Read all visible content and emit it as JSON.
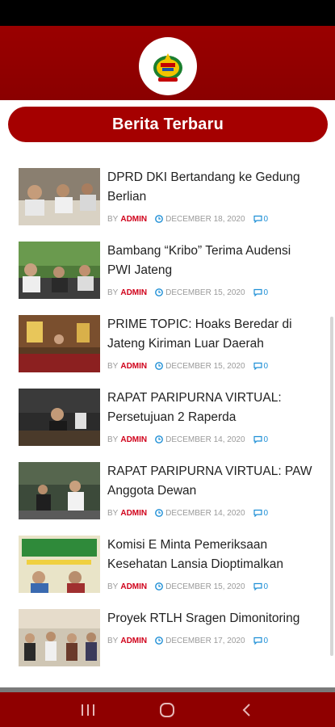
{
  "header": {
    "logo": "provincial-crest-logo",
    "section_title": "Berita Terbaru"
  },
  "colors": {
    "header_bg": "#9a0000",
    "title_pill": "#a50000",
    "author": "#d0021b",
    "accent_blue": "#1e8fd6",
    "nav_bg": "#8f0000"
  },
  "articles": [
    {
      "title": "DPRD DKI Bertandang ke Gedung Berlian",
      "by": "BY",
      "author": "ADMIN",
      "date": "DECEMBER 18, 2020",
      "comments": "0"
    },
    {
      "title": "Bambang “Kribo” Terima Audensi PWI Jateng",
      "by": "BY",
      "author": "ADMIN",
      "date": "DECEMBER 15, 2020",
      "comments": "0"
    },
    {
      "title": "PRIME TOPIC: Hoaks Beredar di Jateng Kiriman Luar Daerah",
      "by": "BY",
      "author": "ADMIN",
      "date": "DECEMBER 15, 2020",
      "comments": "0"
    },
    {
      "title": "RAPAT PARIPURNA VIRTUAL: Persetujuan 2 Raperda",
      "by": "BY",
      "author": "ADMIN",
      "date": "DECEMBER 14, 2020",
      "comments": "0"
    },
    {
      "title": "RAPAT PARIPURNA VIRTUAL: PAW Anggota Dewan",
      "by": "BY",
      "author": "ADMIN",
      "date": "DECEMBER 14, 2020",
      "comments": "0"
    },
    {
      "title": "Komisi E Minta Pemeriksaan Kesehatan Lansia Dioptimalkan",
      "by": "BY",
      "author": "ADMIN",
      "date": "DECEMBER 15, 2020",
      "comments": "0"
    },
    {
      "title": "Proyek RTLH Sragen Dimonitoring",
      "by": "BY",
      "author": "ADMIN",
      "date": "DECEMBER 17, 2020",
      "comments": "0"
    }
  ],
  "nav": {
    "recent_apps": "recent-apps-icon",
    "home": "home-icon",
    "back": "back-icon"
  }
}
